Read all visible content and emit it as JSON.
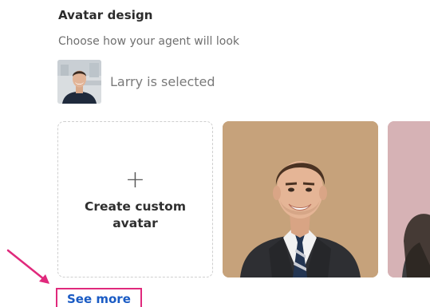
{
  "avatar_section": {
    "title": "Avatar design",
    "subtitle": "Choose how your agent will look",
    "selected_label": "Larry is selected"
  },
  "cards": {
    "create_line1": "Create custom",
    "create_line2": "avatar",
    "plus_symbol": "+"
  },
  "links": {
    "see_more": "See more"
  },
  "colors": {
    "link": "#1a5bc4",
    "annotation": "#e0297c",
    "card_tan": "#c6a27b",
    "card_pink": "#d6b2b5"
  },
  "icons": {
    "annotation_arrow": "arrow-down-right-icon",
    "plus": "plus-icon"
  }
}
